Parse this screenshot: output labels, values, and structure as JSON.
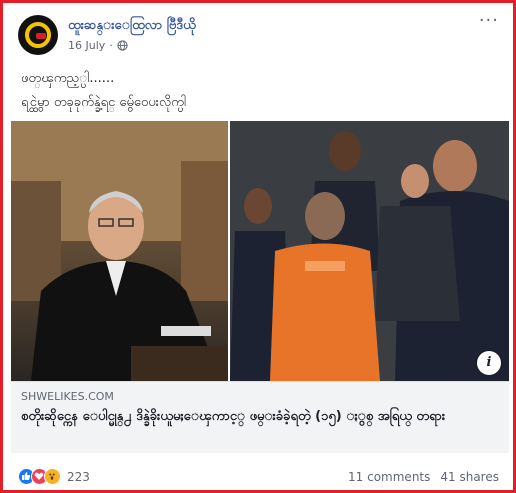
{
  "post": {
    "page_name": "ထူးဆန္းေထြလာ ဗြီဒီယို",
    "date": "16 July",
    "caption_lines": [
      "ဖတ္ၾကည့္ပါ......",
      "ရင္ထဲမွာ တခုခုက်န္ခဲ့ရင္ မွ်ေဝေပးလိုက္ပါ"
    ]
  },
  "link_preview": {
    "domain": "SHWELIKES.COM",
    "title": "စတိုးဆိုင္ကေန ေပါင္မုန္႕ ဒိန္ခဲခိုးယူမႈေၾကာင့္ ဖမ္းခံခဲ့ရတဲ့ (၁၅) ႏွစ္ အရြယ္ တရား"
  },
  "footer": {
    "reaction_count": "223",
    "comments": "11 comments",
    "shares": "41 shares"
  },
  "colors": {
    "frame": "#e41e26",
    "page_name": "#385898",
    "like": "#1877f2",
    "love": "#f33e58",
    "wow": "#f7b125"
  }
}
